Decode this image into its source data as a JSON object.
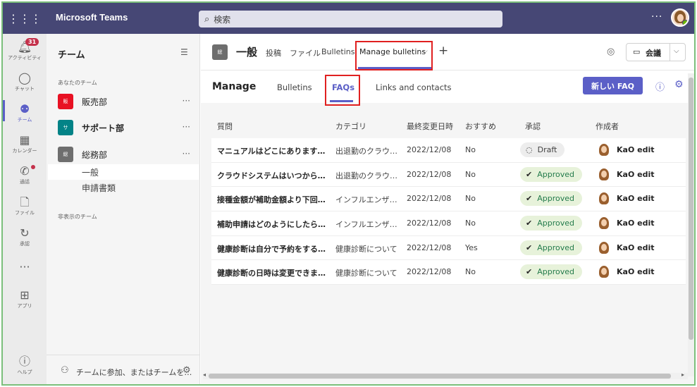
{
  "topbar": {
    "app_name": "Microsoft Teams",
    "search_placeholder": "検索",
    "more": "···"
  },
  "rail": {
    "items": [
      {
        "label": "アクティビティ",
        "icon": "bell-icon",
        "badge": "31"
      },
      {
        "label": "チャット",
        "icon": "chat-icon"
      },
      {
        "label": "チーム",
        "icon": "teams-icon",
        "active": true
      },
      {
        "label": "カレンダー",
        "icon": "calendar-icon"
      },
      {
        "label": "通話",
        "icon": "phone-icon"
      },
      {
        "label": "ファイル",
        "icon": "file-icon"
      },
      {
        "label": "承認",
        "icon": "approvals-icon"
      },
      {
        "label": "···",
        "icon": "more-icon"
      },
      {
        "label": "アプリ",
        "icon": "apps-icon"
      },
      {
        "label": "ヘルプ",
        "icon": "help-icon"
      }
    ]
  },
  "teams_pane": {
    "title": "チーム",
    "your_teams_label": "あなたのチーム",
    "hidden_teams_label": "非表示のチーム",
    "teams": [
      {
        "name": "販売部",
        "tile": "販",
        "color": "#e81123",
        "bold": false
      },
      {
        "name": "サポート部",
        "tile": "サ",
        "color": "#038387",
        "bold": true
      },
      {
        "name": "総務部",
        "tile": "総",
        "color": "#6e6e6e",
        "bold": false
      }
    ],
    "channels": [
      "一般",
      "申請書類"
    ],
    "join_text": "チームに参加、またはチームを…"
  },
  "channel_header": {
    "tile": "総",
    "name": "一般",
    "tabs": [
      "投稿",
      "ファイル",
      "Bulletins",
      "Manage bulletins"
    ],
    "active_tab": "Manage bulletins",
    "meet_label": "会議"
  },
  "manage": {
    "title": "Manage",
    "tabs": [
      "Bulletins",
      "FAQs",
      "Links and contacts"
    ],
    "active_tab": "FAQs",
    "new_button": "新しい FAQ"
  },
  "table": {
    "headers": [
      "質問",
      "カテゴリ",
      "最終変更日時",
      "おすすめ",
      "承認",
      "作成者"
    ],
    "rows": [
      {
        "question": "マニュアルはどこにあります…",
        "category": "出退勤のクラウ…",
        "date": "2022/12/08",
        "recommended": "No",
        "status": "Draft",
        "author": "KaO edit"
      },
      {
        "question": "クラウドシステムはいつから…",
        "category": "出退勤のクラウ…",
        "date": "2022/12/08",
        "recommended": "No",
        "status": "Approved",
        "author": "KaO edit"
      },
      {
        "question": "接種金額が補助金額より下回…",
        "category": "インフルエンザ…",
        "date": "2022/12/08",
        "recommended": "No",
        "status": "Approved",
        "author": "KaO edit"
      },
      {
        "question": "補助申請はどのようにしたら…",
        "category": "インフルエンザ…",
        "date": "2022/12/08",
        "recommended": "No",
        "status": "Approved",
        "author": "KaO edit"
      },
      {
        "question": "健康診断は自分で予約をする…",
        "category": "健康診断について",
        "date": "2022/12/08",
        "recommended": "Yes",
        "status": "Approved",
        "author": "KaO edit"
      },
      {
        "question": "健康診断の日時は変更できま…",
        "category": "健康診断について",
        "date": "2022/12/08",
        "recommended": "No",
        "status": "Approved",
        "author": "KaO edit"
      }
    ]
  },
  "colors": {
    "brand": "#464775",
    "accent": "#5b5fc7",
    "highlight_box": "#e02020",
    "approved_bg": "#e7f2da"
  }
}
